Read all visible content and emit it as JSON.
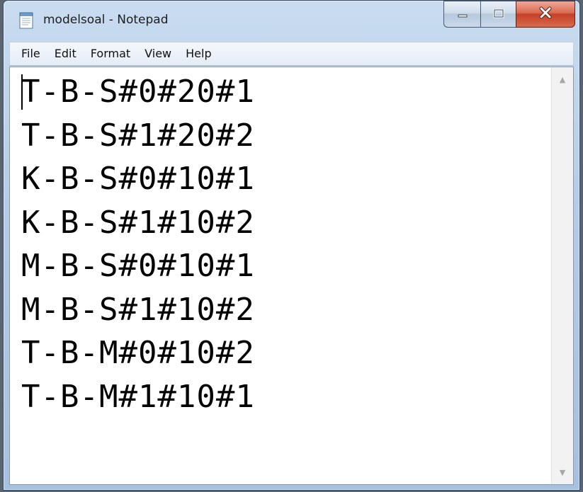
{
  "window": {
    "title": "modelsoal - Notepad"
  },
  "menu": {
    "items": [
      "File",
      "Edit",
      "Format",
      "View",
      "Help"
    ]
  },
  "editor": {
    "lines": [
      "T-B-S#0#20#1",
      "T-B-S#1#20#2",
      "K-B-S#0#10#1",
      "K-B-S#1#10#2",
      "M-B-S#0#10#1",
      "M-B-S#1#10#2",
      "T-B-M#0#10#2",
      "T-B-M#1#10#1"
    ]
  },
  "icons": {
    "app": "notepad-icon",
    "minimize": "minimize-icon",
    "maximize": "maximize-icon",
    "close": "close-icon",
    "scroll_up": "scroll-up-arrow-icon",
    "scroll_down": "scroll-down-arrow-icon"
  },
  "colors": {
    "close_button": "#c3412a",
    "titlebar": "#b3cbe6"
  }
}
